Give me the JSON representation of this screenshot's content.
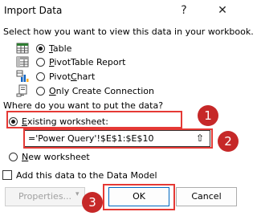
{
  "window": {
    "title": "Import Data",
    "help_label": "?",
    "close_label": "✕"
  },
  "view_prompt": "Select how you want to view this data in your workbook.",
  "view_options": [
    {
      "label_pre": "",
      "label_u": "T",
      "label_post": "able",
      "selected": true,
      "icon": "table-icon"
    },
    {
      "label_pre": "",
      "label_u": "P",
      "label_post": "ivotTable Report",
      "selected": false,
      "icon": "pivottable-icon"
    },
    {
      "label_pre": "Pivot",
      "label_u": "C",
      "label_post": "hart",
      "selected": false,
      "icon": "pivotchart-icon"
    },
    {
      "label_pre": "",
      "label_u": "O",
      "label_post": "nly Create Connection",
      "selected": false,
      "icon": "connection-icon"
    }
  ],
  "location_prompt": "Where do you want to put the data?",
  "existing_worksheet": {
    "label_pre": "",
    "label_u": "E",
    "label_post": "xisting worksheet:",
    "selected": true
  },
  "range_value": "='Power Query'!$E$1:$E$10",
  "collapse_label": "⇧",
  "new_worksheet": {
    "label_pre": "",
    "label_u": "N",
    "label_post": "ew worksheet",
    "selected": false
  },
  "data_model": {
    "label": "Add this data to the Data Model",
    "checked": false
  },
  "buttons": {
    "properties": "Properties...",
    "properties_arrow": "▾",
    "ok": "OK",
    "cancel": "Cancel"
  },
  "annotations": [
    "1",
    "2",
    "3"
  ],
  "colors": {
    "annotation": "#e53935",
    "badge": "#c62828",
    "primary_border": "#0067c0"
  }
}
